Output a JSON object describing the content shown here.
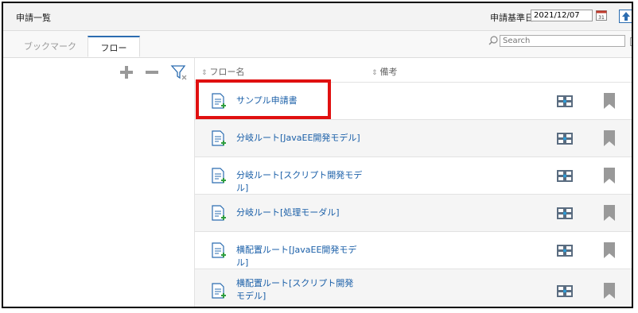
{
  "window": {
    "title": "申請一覧",
    "base_date_label": "申請基準日",
    "base_date_value": "2021/12/07"
  },
  "tabs": [
    {
      "label": "ブックマーク",
      "active": false
    },
    {
      "label": "フロー",
      "active": true
    }
  ],
  "search": {
    "placeholder": "Search"
  },
  "columns": {
    "name": "フロー名",
    "note": "備考"
  },
  "flows": [
    {
      "name": "サンプル申請書"
    },
    {
      "name": "分岐ルート[JavaEE開発モデル]"
    },
    {
      "name": "分岐ルート[スクリプト開発モデル]"
    },
    {
      "name": "分岐ルート[処理モーダル]"
    },
    {
      "name": "横配置ルート[JavaEE開発モデル]"
    },
    {
      "name": "横配置ルート[スクリプト開発モデル]"
    }
  ],
  "colors": {
    "accent": "#2b6cb0",
    "highlight": "#e01010",
    "link": "#1a5fa8",
    "doc_icon": "#2b6cb0",
    "doc_plus": "#2e9e3e"
  }
}
